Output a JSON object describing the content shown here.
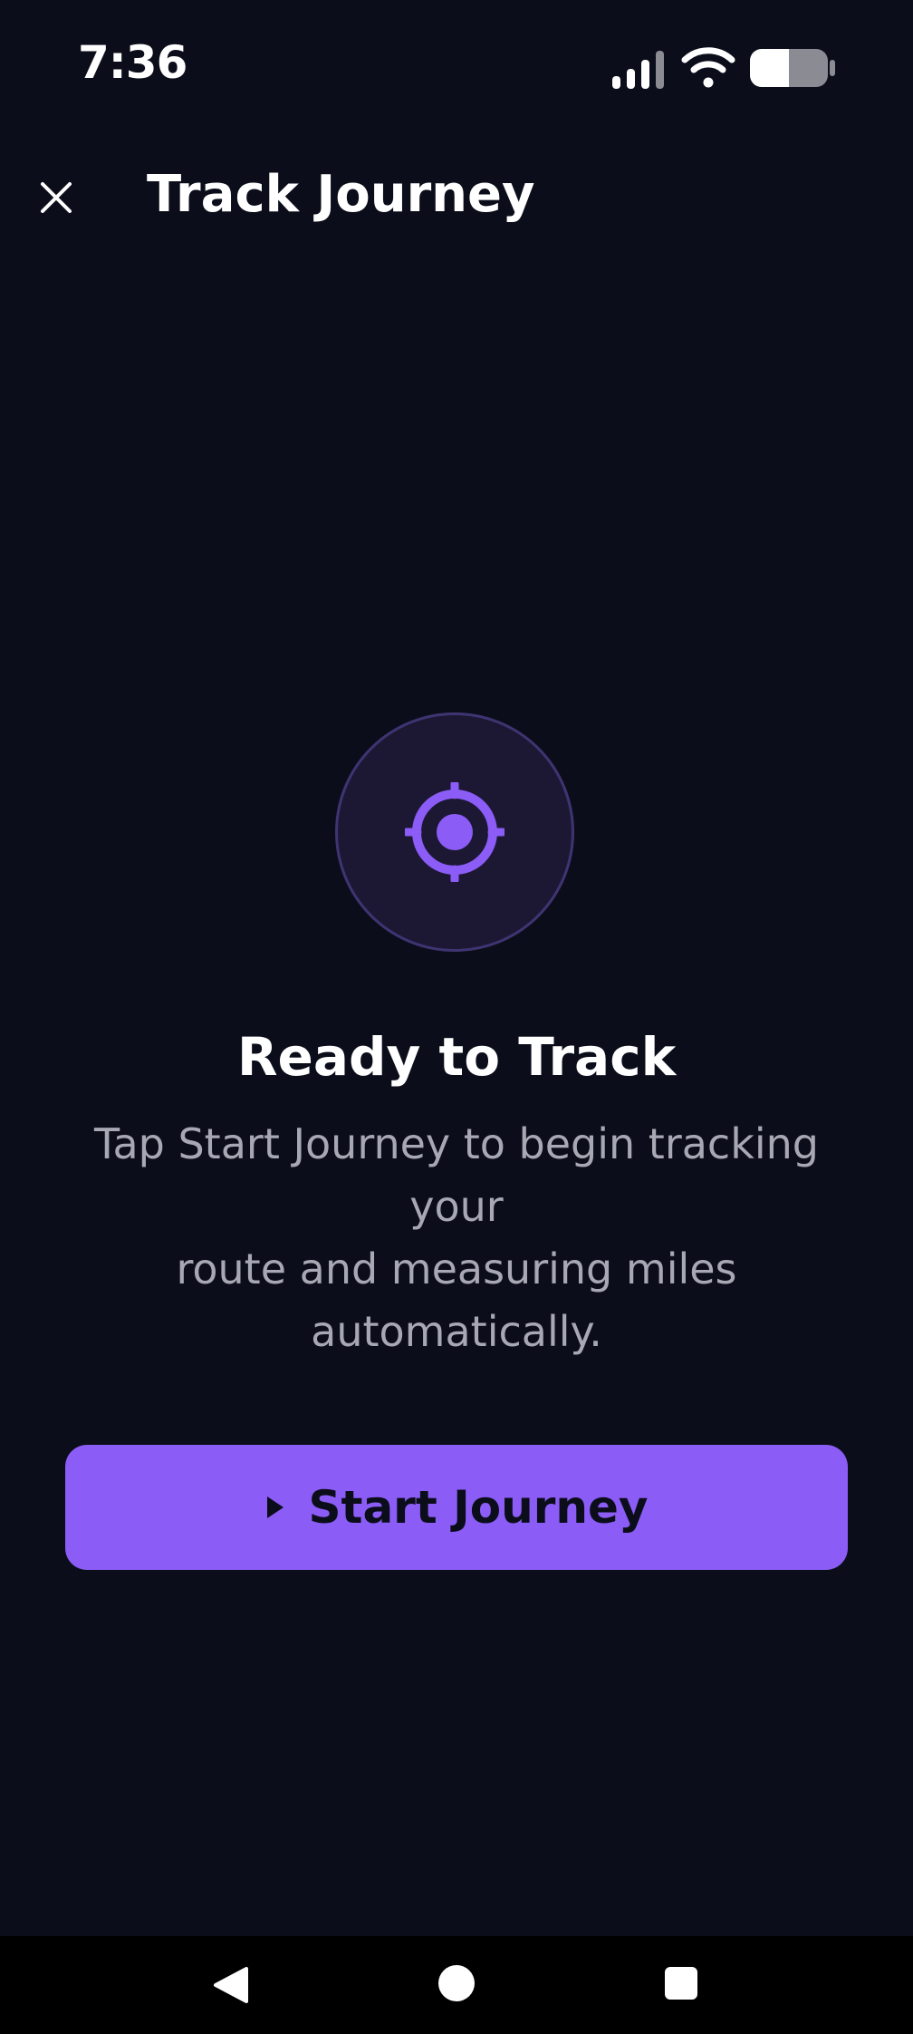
{
  "status_bar": {
    "time": "7:36",
    "icons": [
      "signal-icon",
      "wifi-icon",
      "battery-icon"
    ],
    "battery_level": 0.5
  },
  "app_bar": {
    "title": "Track Journey",
    "close_icon": "close-icon"
  },
  "empty_state": {
    "icon": "crosshair-icon",
    "title": "Ready to Track",
    "description_line1": "Tap Start Journey to begin tracking",
    "description_line2": "your",
    "description_line3": "route and measuring miles",
    "description_line4": "automatically."
  },
  "actions": {
    "start_label": "Start Journey",
    "start_icon": "play-icon"
  },
  "nav_bar": {
    "icons": [
      "back-icon",
      "home-icon",
      "recents-icon"
    ]
  },
  "colors": {
    "background": "#0b0e1a",
    "accent": "#8b5cf6",
    "icon_circle": "#1c1834",
    "muted_text": "#a7a8b3"
  }
}
